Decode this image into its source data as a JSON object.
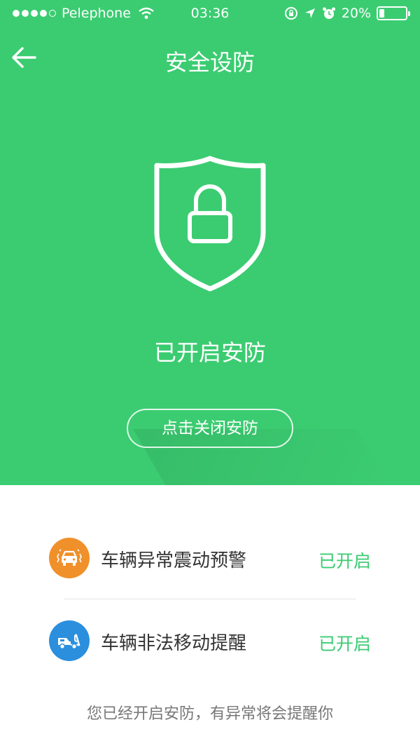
{
  "status_bar": {
    "carrier": "Pelephone",
    "time": "03:36",
    "battery_text": "20%",
    "battery_level": 0.2,
    "signal_bars": 4,
    "signal_total": 5
  },
  "nav": {
    "title": "安全设防",
    "back_icon": "arrow-left-icon"
  },
  "hero": {
    "icon": "shield-lock-icon",
    "state_title": "已开启安防",
    "close_button_label": "点击关闭安防"
  },
  "items": [
    {
      "label": "车辆异常震动预警",
      "status": "已开启",
      "icon": "car-vibration-icon",
      "color": "#f0902a"
    },
    {
      "label": "车辆非法移动提醒",
      "status": "已开启",
      "icon": "tow-truck-icon",
      "color": "#2b8fde"
    }
  ],
  "footnote": "您已经开启安防，有异常将会提醒你",
  "colors": {
    "accent": "#3bcc71",
    "text": "#333333",
    "muted": "#777777"
  }
}
